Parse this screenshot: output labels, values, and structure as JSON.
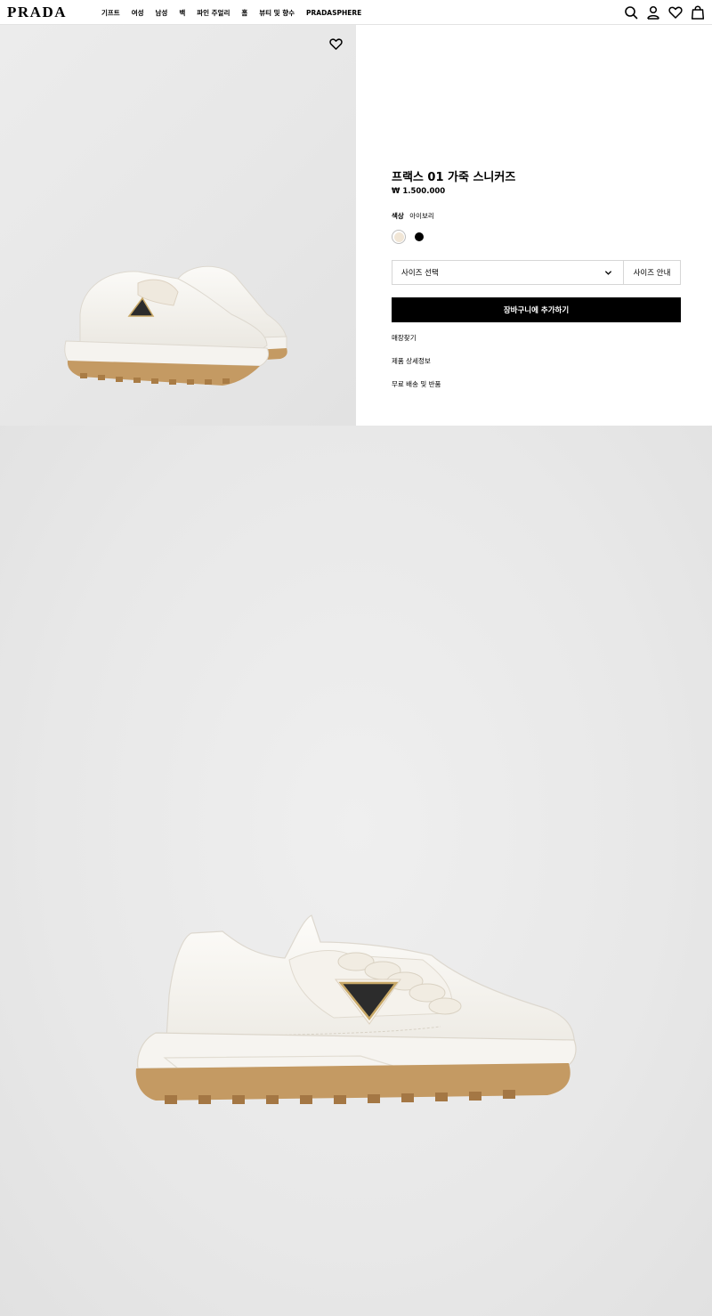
{
  "header": {
    "logo": "PRADA",
    "nav": [
      "기프트",
      "여성",
      "남성",
      "백",
      "파인 주얼리",
      "홈",
      "뷰티 및 향수",
      "PRADASPHERE"
    ],
    "icons": [
      "search-icon",
      "account-icon",
      "wishlist-icon",
      "bag-icon"
    ]
  },
  "product": {
    "title": "프랙스 01 가죽 스니커즈",
    "price": "₩ 1.500.000",
    "color_label": "색상",
    "color_value": "아이보리",
    "swatches": [
      {
        "name": "ivory",
        "color": "#f1e6d6",
        "selected": true
      },
      {
        "name": "black",
        "color": "#000000",
        "selected": false
      }
    ],
    "size_select": "사이즈 선택",
    "size_guide": "사이즈 안내",
    "add_to_cart": "장바구니에 추가하기",
    "links": [
      "매장찾기",
      "제품 상세정보",
      "무료 배송 및 반품"
    ]
  },
  "colors": {
    "sole": "#c49a63",
    "upper": "#f7f5f0",
    "logo_plate": "#2c2c2c",
    "logo_gold": "#c9a968"
  }
}
